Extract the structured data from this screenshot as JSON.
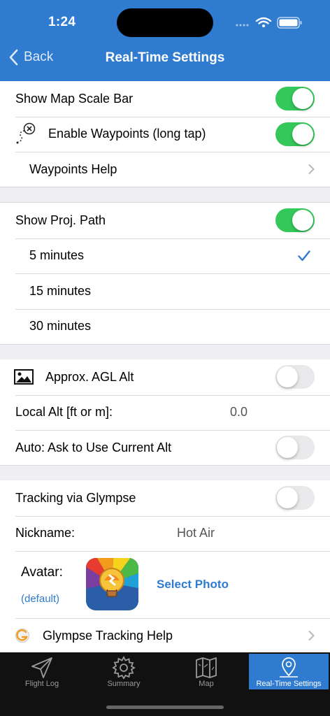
{
  "status_bar": {
    "time": "1:24"
  },
  "nav": {
    "back_label": "Back",
    "title": "Real-Time Settings"
  },
  "map_group": {
    "scale_bar": {
      "label": "Show Map Scale Bar",
      "on": true
    },
    "waypoints": {
      "label": "Enable Waypoints (long tap)",
      "on": true,
      "icon": "treasure-map-icon"
    },
    "waypoints_help": {
      "label": "Waypoints Help"
    }
  },
  "path_group": {
    "show_path": {
      "label": "Show Proj. Path",
      "on": true
    },
    "options": [
      {
        "label": "5 minutes",
        "selected": true
      },
      {
        "label": "15 minutes",
        "selected": false
      },
      {
        "label": "30 minutes",
        "selected": false
      }
    ]
  },
  "alt_group": {
    "agl": {
      "label": "Approx. AGL Alt",
      "on": false,
      "icon": "image-icon"
    },
    "local_alt": {
      "label": "Local Alt [ft or m]:",
      "value": "0.0"
    },
    "auto_alt": {
      "label": "Auto: Ask to Use Current Alt",
      "on": false
    }
  },
  "glympse_group": {
    "tracking": {
      "label": "Tracking via Glympse",
      "on": false
    },
    "nickname": {
      "label": "Nickname:",
      "value": "Hot Air"
    },
    "avatar": {
      "label": "Avatar:",
      "default_label": "(default)",
      "select_label": "Select Photo",
      "image": "hot-air-balloon-avatar"
    },
    "help": {
      "label": "Glympse Tracking Help",
      "icon": "glympse-logo-icon"
    }
  },
  "tabs": [
    {
      "label": "Flight Log",
      "icon": "paper-plane-icon",
      "active": false
    },
    {
      "label": "Summary",
      "icon": "gear-icon",
      "active": false
    },
    {
      "label": "Map",
      "icon": "map-icon",
      "active": false
    },
    {
      "label": "Real-Time Settings",
      "icon": "location-pin-icon",
      "active": true
    }
  ],
  "colors": {
    "header": "#2f7bd0",
    "toggle_on": "#34c759",
    "accent": "#2f7bd0",
    "tabbar": "#111111"
  }
}
